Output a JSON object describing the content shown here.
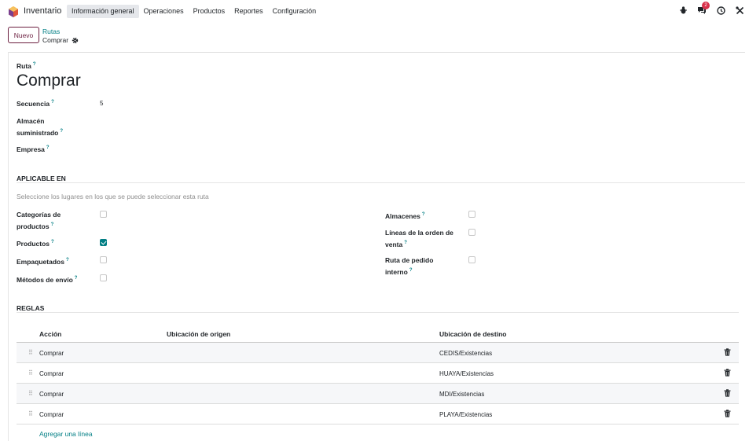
{
  "navbar": {
    "app_name": "Inventario",
    "menu": [
      "Información general",
      "Operaciones",
      "Productos",
      "Reportes",
      "Configuración"
    ],
    "active_menu": 0,
    "messages_count": "2"
  },
  "control": {
    "new_label": "Nuevo",
    "breadcrumb_parent": "Rutas",
    "breadcrumb_current": "Comprar"
  },
  "form": {
    "route_label": "Ruta",
    "route_name": "Comprar",
    "sequence_label": "Secuencia",
    "sequence_value": "5",
    "warehouse_label_1": "Almacén",
    "warehouse_label_2": "suministrado",
    "company_label": "Empresa"
  },
  "applicable": {
    "section_title": "APLICABLE EN",
    "hint": "Seleccione los lugares en los que se puede seleccionar esta ruta",
    "left": [
      {
        "label1": "Categorías de",
        "label2": "productos",
        "checked": false
      },
      {
        "label1": "Productos",
        "label2": "",
        "checked": true
      },
      {
        "label1": "Empaquetados",
        "label2": "",
        "checked": false
      },
      {
        "label1": "Métodos de envío",
        "label2": "",
        "checked": false
      }
    ],
    "right": [
      {
        "label1": "Almacenes",
        "label2": "",
        "checked": false
      },
      {
        "label1": "Líneas de la orden de",
        "label2": "venta",
        "checked": false
      },
      {
        "label1": "Ruta de pedido",
        "label2": "interno",
        "checked": false
      }
    ]
  },
  "rules": {
    "section_title": "REGLAS",
    "columns": [
      "Acción",
      "Ubicación de origen",
      "Ubicación de destino"
    ],
    "rows": [
      {
        "action": "Comprar",
        "origin": "",
        "destination": "CEDIS/Existencias"
      },
      {
        "action": "Comprar",
        "origin": "",
        "destination": "HUAYA/Existencias"
      },
      {
        "action": "Comprar",
        "origin": "",
        "destination": "MDI/Existencias"
      },
      {
        "action": "Comprar",
        "origin": "",
        "destination": "PLAYA/Existencias"
      }
    ],
    "add_line": "Agregar una línea"
  },
  "colors": {
    "brand": "#6c1f40",
    "accent": "#017e84",
    "badge": "#d9314b"
  }
}
